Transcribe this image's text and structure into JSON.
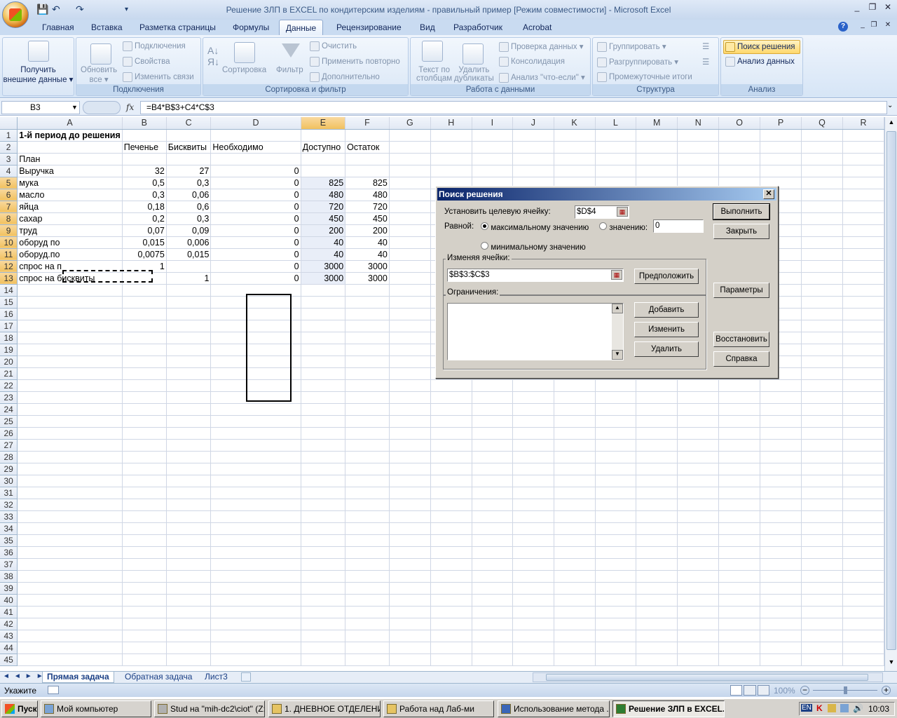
{
  "window": {
    "title": "Решение ЗЛП в EXCEL по кондитерским изделиям - правильный пример  [Режим совместимости] - Microsoft Excel"
  },
  "ribbon_tabs": [
    "Главная",
    "Вставка",
    "Разметка страницы",
    "Формулы",
    "Данные",
    "Рецензирование",
    "Вид",
    "Разработчик",
    "Acrobat"
  ],
  "active_tab": "Данные",
  "ribbon": {
    "get_data": "Получить",
    "get_data2": "внешние данные",
    "refresh": "Обновить",
    "refresh2": "все",
    "connections": "Подключения",
    "properties": "Свойства",
    "edit_links": "Изменить связи",
    "group_connections": "Подключения",
    "sort": "Сортировка",
    "filter": "Фильтр",
    "clear": "Очистить",
    "reapply": "Применить повторно",
    "advanced": "Дополнительно",
    "group_sort": "Сортировка и фильтр",
    "text_to_columns": "Текст по",
    "text_to_columns2": "столбцам",
    "remove_dups": "Удалить",
    "remove_dups2": "дубликаты",
    "validation": "Проверка данных",
    "consolidate": "Консолидация",
    "whatif": "Анализ \"что-если\"",
    "group_data": "Работа с данными",
    "group_btn": "Группировать",
    "ungroup_btn": "Разгруппировать",
    "subtotals": "Промежуточные итоги",
    "group_outline": "Структура",
    "solver": "Поиск решения",
    "data_analysis": "Анализ данных",
    "group_analysis": "Анализ"
  },
  "formula_bar": {
    "name_box": "B3",
    "fx": "fx",
    "formula": "=B4*B$3+C4*C$3"
  },
  "columns": [
    "A",
    "B",
    "C",
    "D",
    "E",
    "F",
    "G",
    "H",
    "I",
    "J",
    "K",
    "L",
    "M",
    "N",
    "O",
    "P",
    "Q",
    "R"
  ],
  "rows": [
    [
      "1-й период до решения",
      "",
      "",
      "",
      "",
      ""
    ],
    [
      "",
      "Печенье",
      "Бисквиты",
      "Необходимо",
      "Доступно",
      "Остаток"
    ],
    [
      "План",
      "",
      "",
      "",
      "",
      ""
    ],
    [
      "Выручка",
      "32",
      "27",
      "0",
      "",
      ""
    ],
    [
      "мука",
      "0,5",
      "0,3",
      "0",
      "825",
      "825"
    ],
    [
      "масло",
      "0,3",
      "0,06",
      "0",
      "480",
      "480"
    ],
    [
      "яйца",
      "0,18",
      "0,6",
      "0",
      "720",
      "720"
    ],
    [
      "сахар",
      "0,2",
      "0,3",
      "0",
      "450",
      "450"
    ],
    [
      "труд",
      "0,07",
      "0,09",
      "0",
      "200",
      "200"
    ],
    [
      "оборуд по",
      "0,015",
      "0,006",
      "0",
      "40",
      "40"
    ],
    [
      "оборуд.по",
      "0,0075",
      "0,015",
      "0",
      "40",
      "40"
    ],
    [
      "спрос на п",
      "1",
      "",
      "0",
      "3000",
      "3000"
    ],
    [
      "спрос на бисквиты",
      "",
      "1",
      "0",
      "3000",
      "3000"
    ]
  ],
  "row_count": 45,
  "sheet_tabs": [
    "Прямая задача",
    "Обратная задача",
    "Лист3"
  ],
  "status": {
    "mode": "Укажите",
    "zoom": "100%"
  },
  "taskbar": {
    "start": "Пуск",
    "items": [
      "Мой компьютер",
      "Stud на \"mih-dc2\\ciot\" (Z:)",
      "1. ДНЕВНОЕ ОТДЕЛЕНИЕ",
      "Работа над Лаб-ми",
      "Использование метода ...",
      "Решение ЗЛП в EXCEL..."
    ],
    "lang": "EN",
    "time": "10:03"
  },
  "solver": {
    "title": "Поиск решения",
    "target_label": "Установить целевую ячейку:",
    "target_value": "$D$4",
    "equal_label": "Равной:",
    "opt_max": "максимальному значению",
    "opt_value": "значению:",
    "value_field": "0",
    "opt_min": "минимальному значению",
    "changing_label": "Изменяя ячейки:",
    "changing_value": "$B$3:$C$3",
    "guess": "Предположить",
    "constraints_label": "Ограничения:",
    "add": "Добавить",
    "change": "Изменить",
    "delete": "Удалить",
    "solve": "Выполнить",
    "close": "Закрыть",
    "options": "Параметры",
    "reset": "Восстановить",
    "help": "Справка"
  }
}
